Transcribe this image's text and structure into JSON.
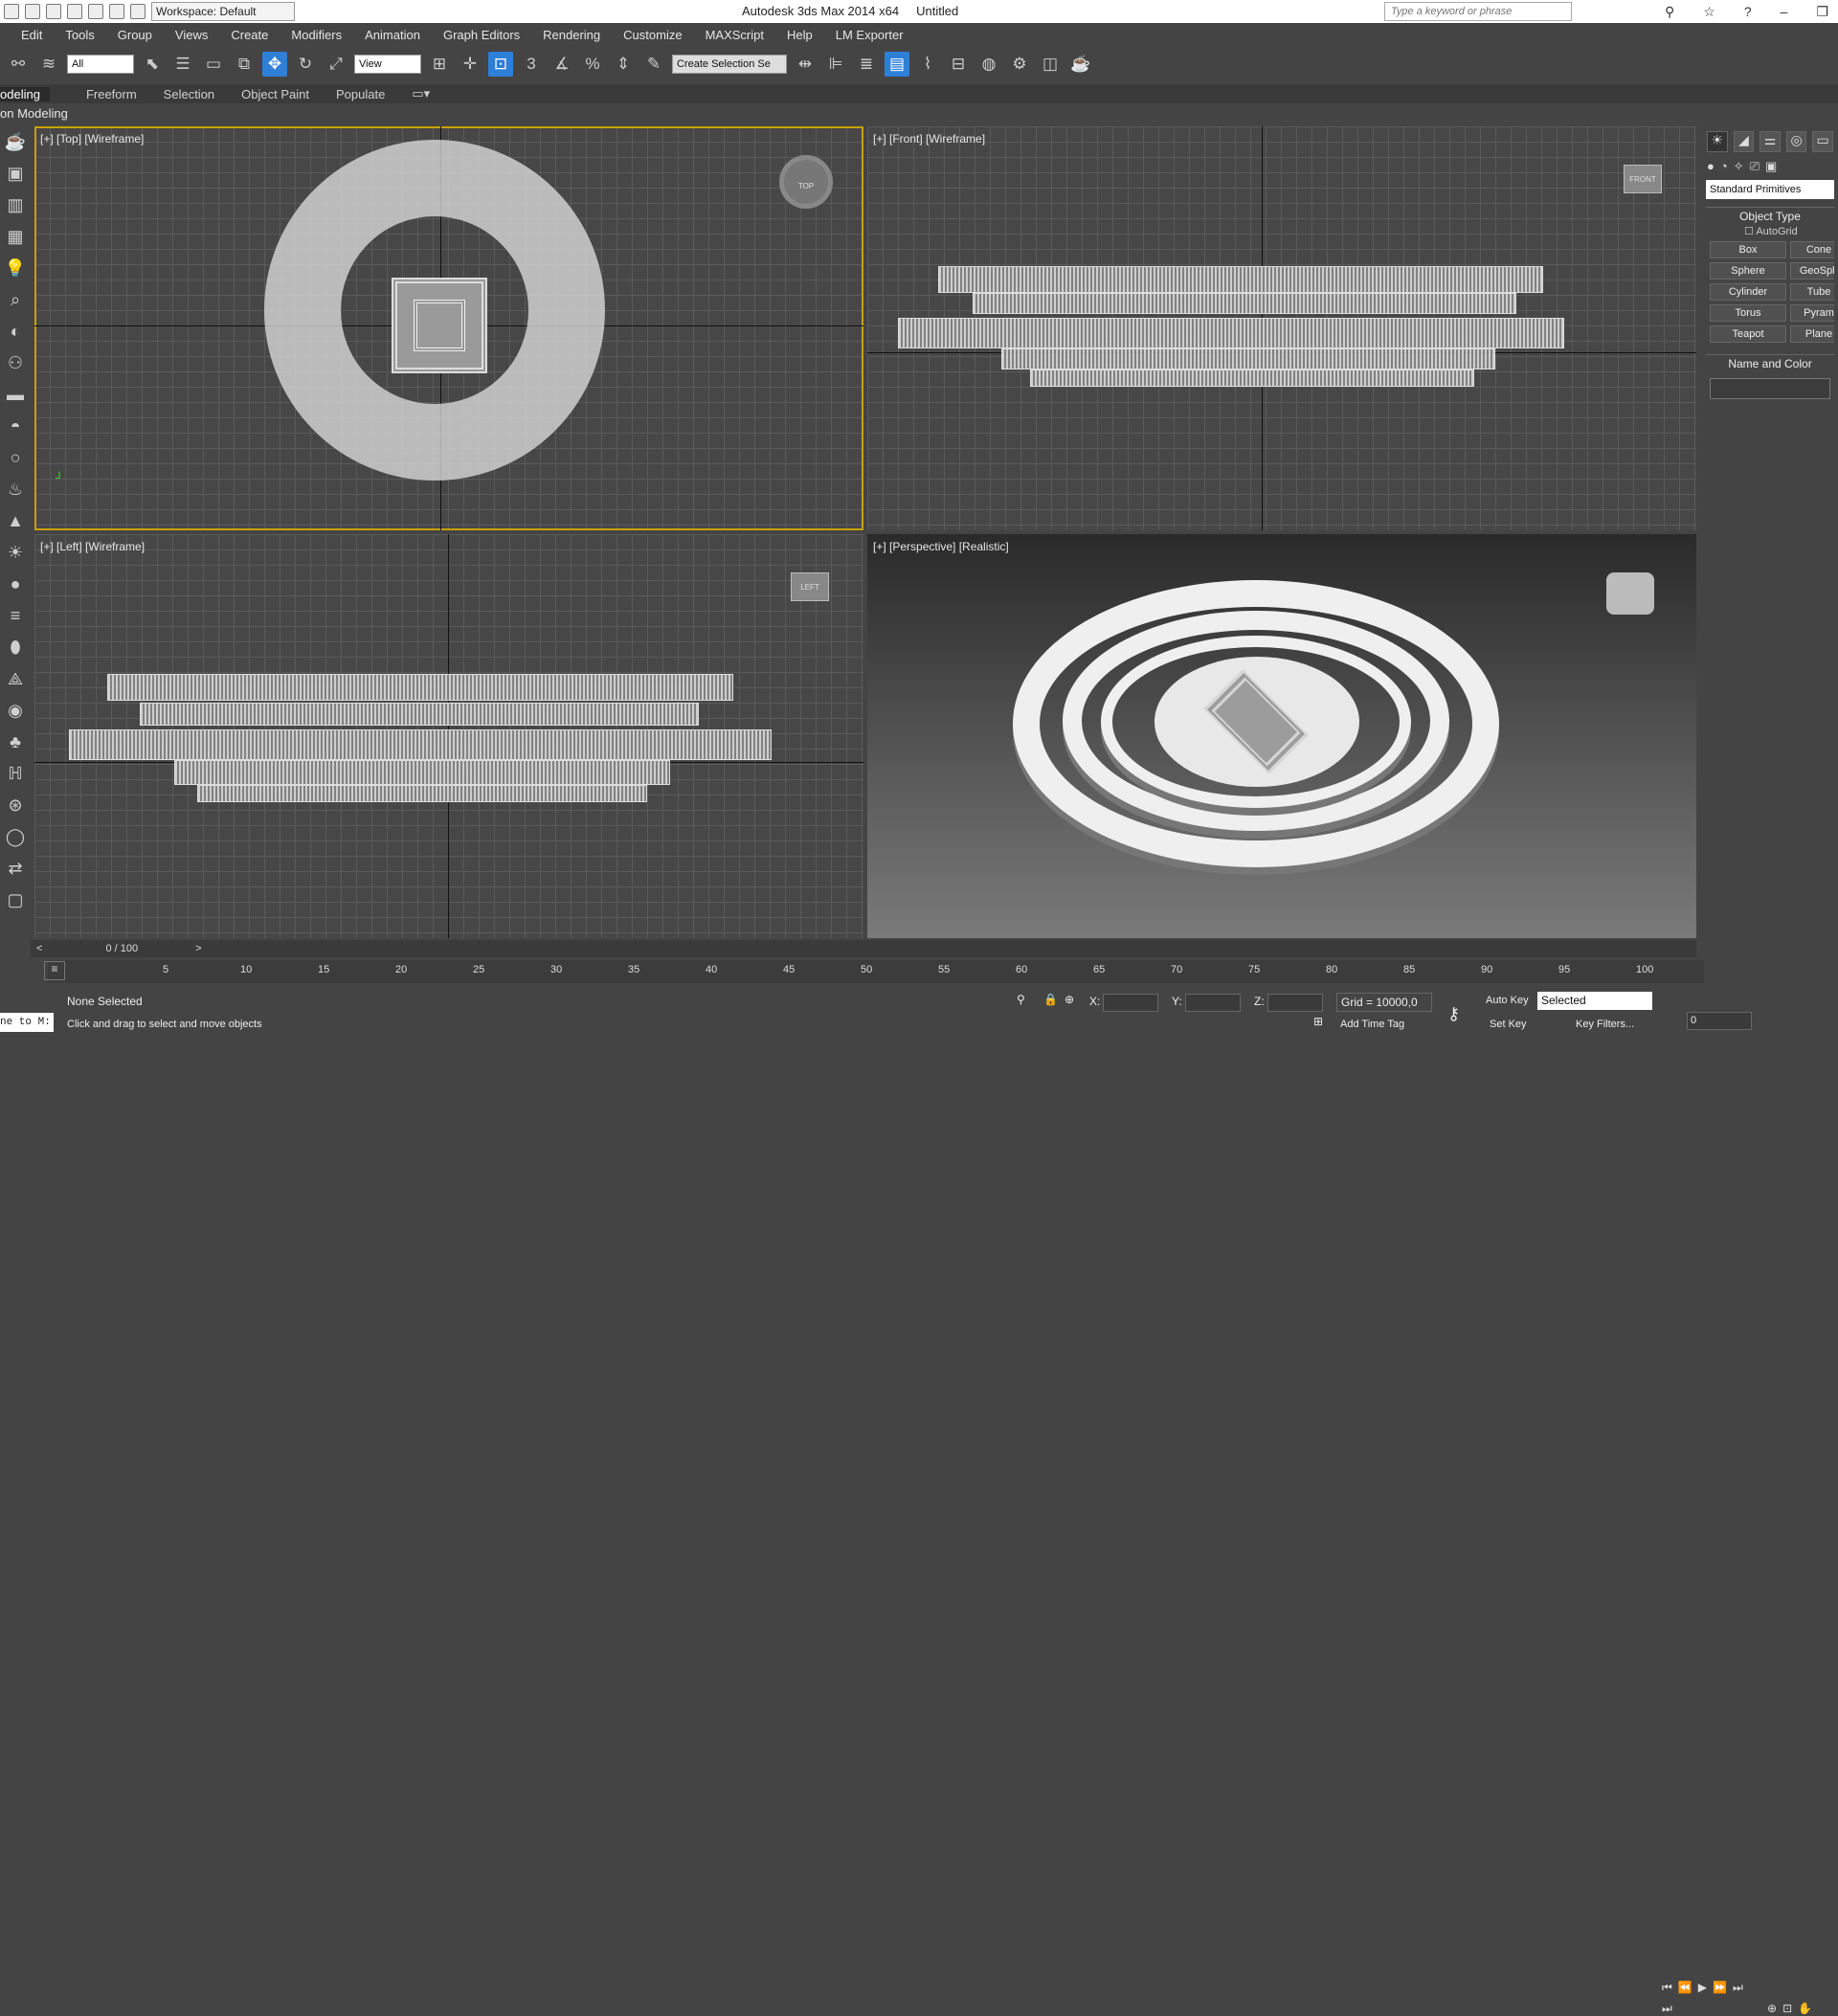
{
  "title": {
    "app": "Autodesk 3ds Max  2014 x64",
    "file": "Untitled"
  },
  "workspace": "Workspace: Default",
  "search": {
    "placeholder": "Type a keyword or phrase"
  },
  "menu": [
    "Edit",
    "Tools",
    "Group",
    "Views",
    "Create",
    "Modifiers",
    "Animation",
    "Graph Editors",
    "Rendering",
    "Customize",
    "MAXScript",
    "Help",
    "LM Exporter"
  ],
  "toolbar": {
    "filter": "All",
    "refcoord": "View",
    "selset": "Create Selection Se"
  },
  "ribbon": {
    "tabs": [
      "odeling",
      "Freeform",
      "Selection",
      "Object Paint",
      "Populate"
    ],
    "sub": "on Modeling"
  },
  "viewports": {
    "top": "[+] [Top] [Wireframe]",
    "front": "[+] [Front] [Wireframe]",
    "left": "[+] [Left] [Wireframe]",
    "persp": "[+] [Perspective] [Realistic]",
    "cube_top": "TOP",
    "cube_front": "FRONT",
    "cube_left": "LEFT"
  },
  "cmdpanel": {
    "category": "Standard Primitives",
    "object_type": "Object Type",
    "autogrid": "AutoGrid",
    "buttons": [
      "Box",
      "Cone",
      "Sphere",
      "GeoSph",
      "Cylinder",
      "Tube",
      "Torus",
      "Pyram",
      "Teapot",
      "Plane"
    ],
    "name_color": "Name and Color"
  },
  "timeline": {
    "frame": "0 / 100",
    "ticks": [
      "5",
      "10",
      "15",
      "20",
      "25",
      "30",
      "35",
      "40",
      "45",
      "50",
      "55",
      "60",
      "65",
      "70",
      "75",
      "80",
      "85",
      "90",
      "95",
      "100"
    ]
  },
  "status": {
    "selection": "None Selected",
    "prompt": "Click and drag to select and move objects",
    "grid": "Grid = 10000,0",
    "x": "X:",
    "y": "Y:",
    "z": "Z:",
    "autokey": "Auto Key",
    "selected": "Selected",
    "setkey": "Set Key",
    "keyfilters": "Key Filters...",
    "addtimetag": "Add Time Tag",
    "frame_num": "0",
    "maxscript": "ne to M:"
  }
}
